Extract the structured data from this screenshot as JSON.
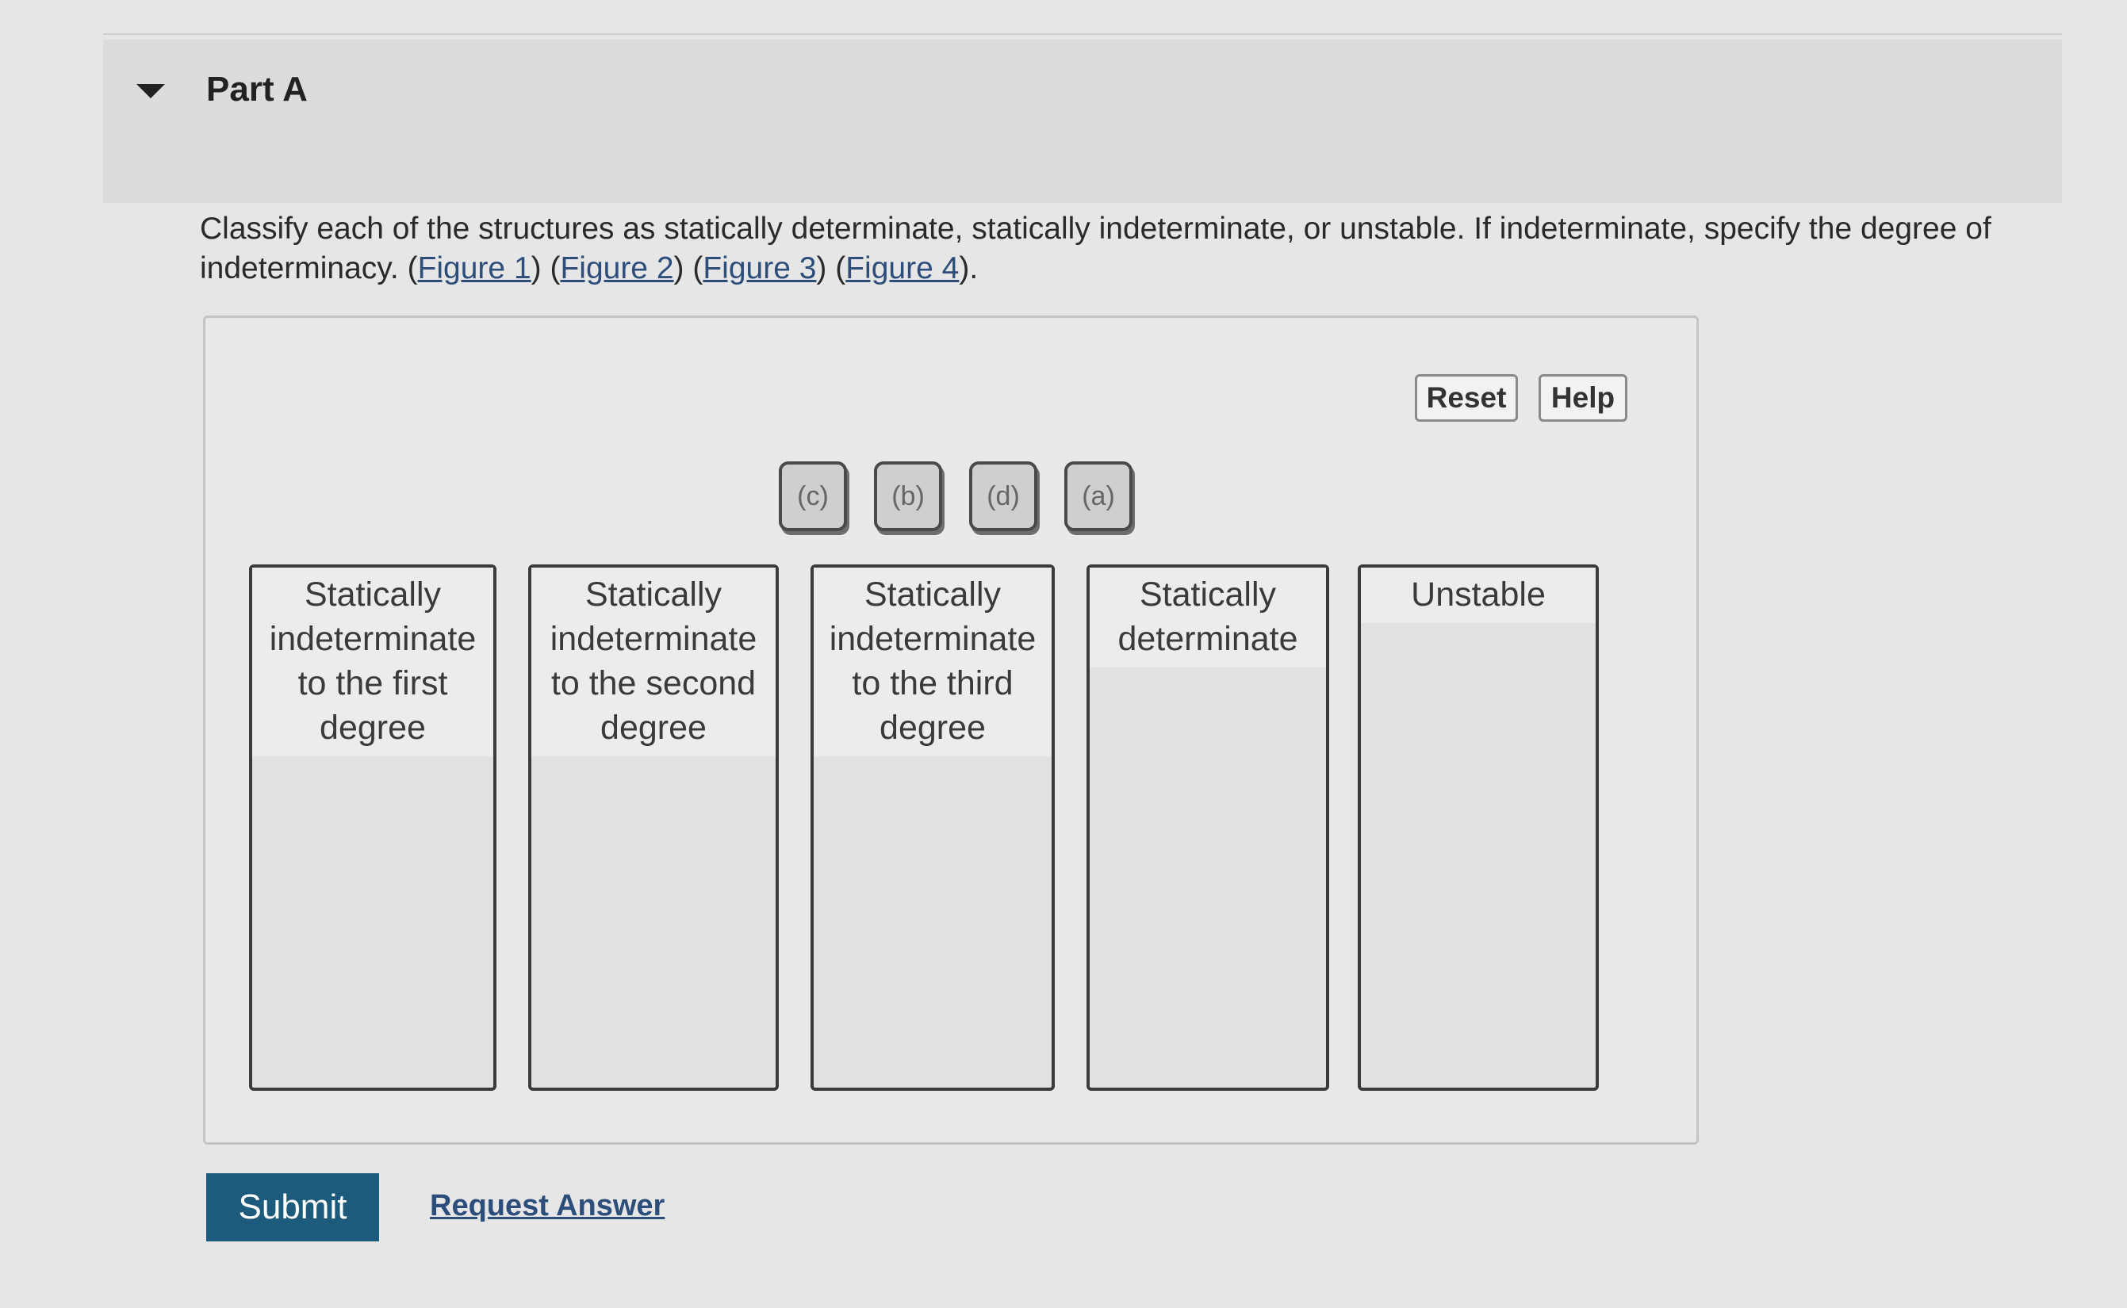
{
  "part": {
    "title": "Part A"
  },
  "question": {
    "text": "Classify each of the structures as statically determinate, statically indeterminate, or unstable. If indeterminate, specify the degree of indeterminacy. ",
    "figures": [
      "Figure 1",
      "Figure 2",
      "Figure 3",
      "Figure 4"
    ],
    "end_punct": "."
  },
  "toolbar": {
    "reset_label": "Reset",
    "help_label": "Help"
  },
  "tokens": [
    "(c)",
    "(b)",
    "(d)",
    "(a)"
  ],
  "bins": [
    {
      "label": "Statically indeterminate to the first degree"
    },
    {
      "label": "Statically indeterminate to the second degree"
    },
    {
      "label": "Statically indeterminate to the third degree"
    },
    {
      "label": "Statically determinate"
    },
    {
      "label": "Unstable"
    }
  ],
  "actions": {
    "submit_label": "Submit",
    "request_answer_label": "Request Answer"
  },
  "colors": {
    "submit_bg": "#1d5b7d",
    "link": "#2d4d7a"
  }
}
